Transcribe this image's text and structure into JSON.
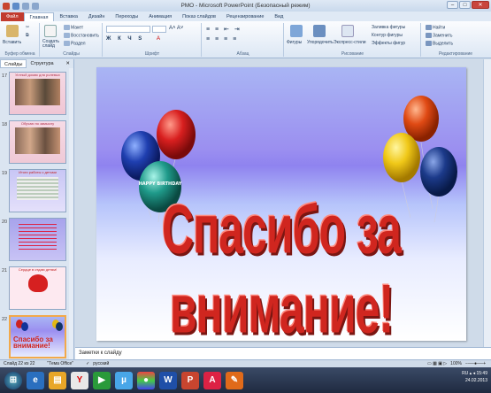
{
  "window": {
    "title": "РМО - Microsoft PowerPoint (Безопасный режим)"
  },
  "tabs": [
    "Файл",
    "Главная",
    "Вставка",
    "Дизайн",
    "Переходы",
    "Анимация",
    "Показ слайдов",
    "Рецензирование",
    "Вид"
  ],
  "ribbon": {
    "clipboard": {
      "paste": "Вставить",
      "group": "Буфер обмена"
    },
    "slides": {
      "create": "Создать слайд",
      "layout": "Макет",
      "reset": "Восстановить",
      "section": "Раздел",
      "group": "Слайды"
    },
    "font": {
      "group": "Шрифт"
    },
    "paragraph": {
      "group": "Абзац"
    },
    "drawing": {
      "shapes": "Фигуры",
      "arrange": "Упорядочить",
      "quick_styles": "Экспресс-стили",
      "fill": "Заливка фигуры",
      "outline": "Контур фигуры",
      "effects": "Эффекты фигур",
      "group": "Рисование"
    },
    "editing": {
      "find": "Найти",
      "replace": "Заменить",
      "select": "Выделить",
      "group": "Редактирование"
    }
  },
  "panel": {
    "tab_slides": "Слайды",
    "tab_outline": "Структура"
  },
  "thumbnails": [
    {
      "num": "17",
      "title": "Устный домик для ролевых"
    },
    {
      "num": "18",
      "title": "Обучаю по замыслу"
    },
    {
      "num": "19",
      "title": "Итоги работы с детьми"
    },
    {
      "num": "20",
      "title": ""
    },
    {
      "num": "21",
      "title": "Сердце в отдаю детям!"
    },
    {
      "num": "22",
      "title": "Спасибо за внимание!"
    }
  ],
  "slide": {
    "headline": "Спасибо за внимание!",
    "balloon_text": "HAPPY BIRTHDAY"
  },
  "notes": {
    "placeholder": "Заметки к слайду"
  },
  "status": {
    "slide": "Слайд 22 из 22",
    "theme": "\"Тема Office\"",
    "lang": "русский",
    "zoom": "100%"
  },
  "taskbar": {
    "lang": "RU",
    "time": "15:49",
    "date": "24.02.2013"
  }
}
